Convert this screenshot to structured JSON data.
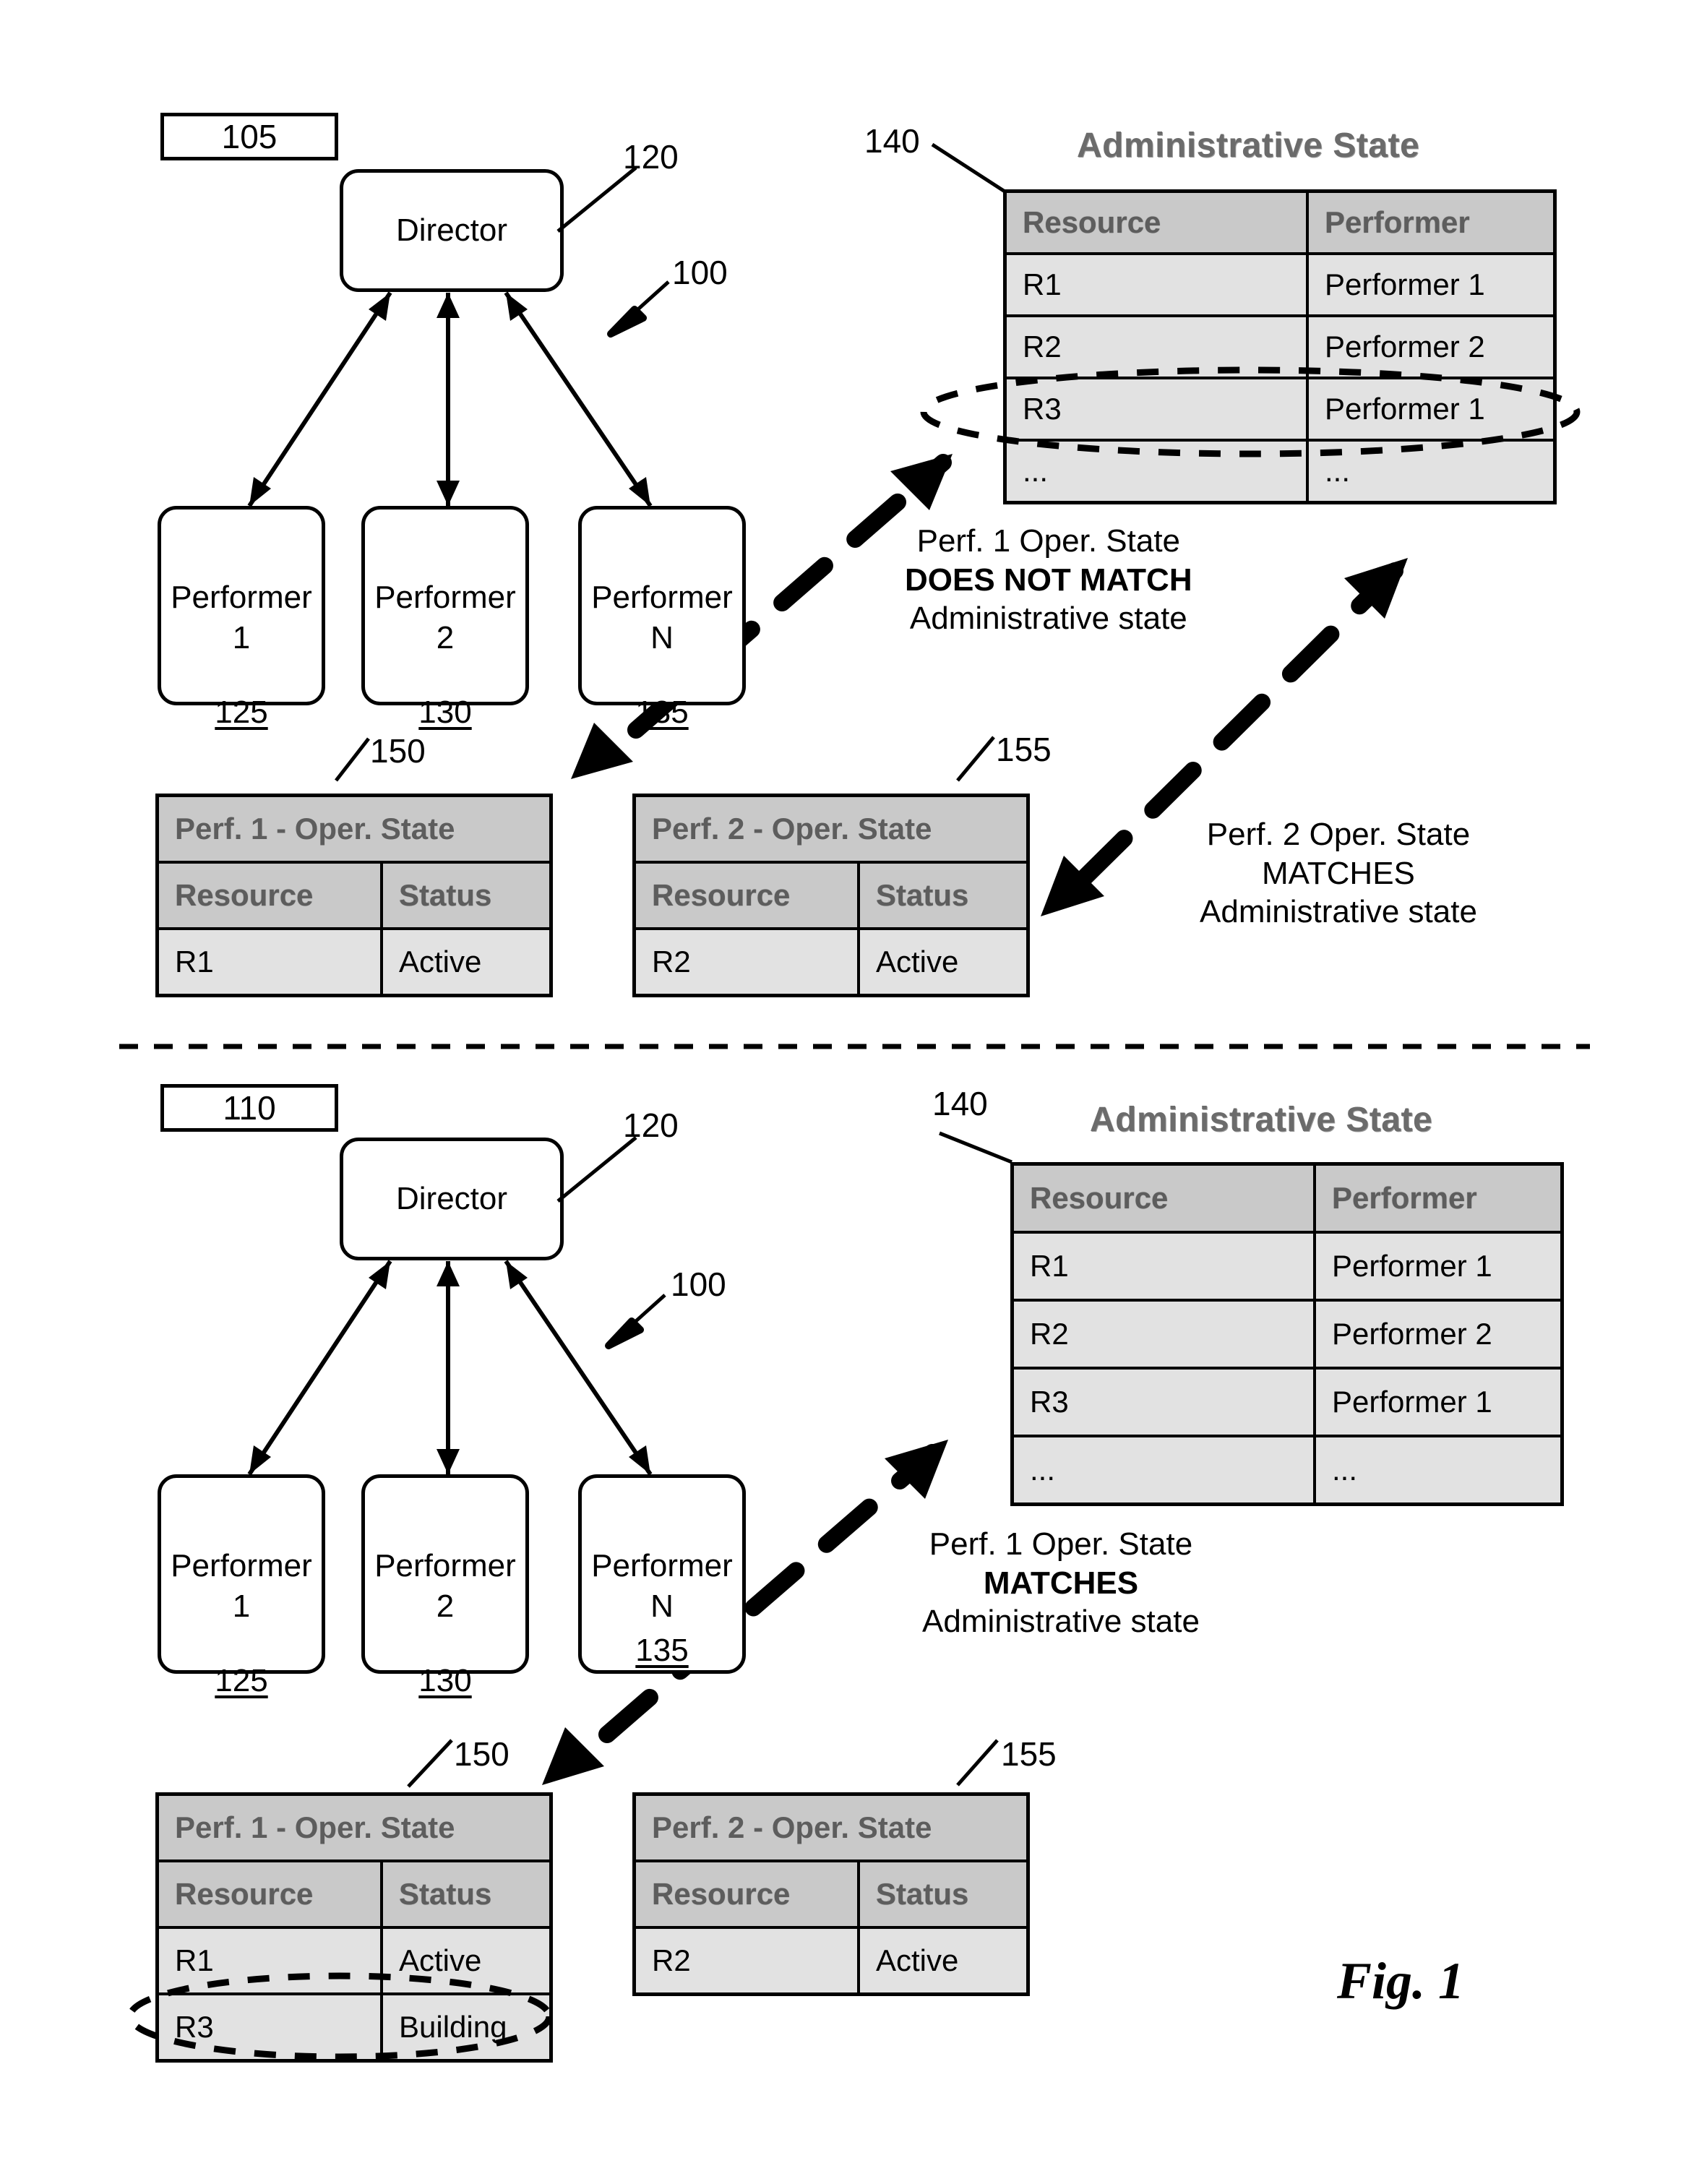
{
  "figure": {
    "label": "Fig. 1"
  },
  "panels": [
    {
      "id": "top",
      "ref_box": "105",
      "system_ref": "100",
      "director": {
        "label": "Director",
        "ref": "120"
      },
      "performers": [
        {
          "name": "Performer",
          "index": "1",
          "ref": "125"
        },
        {
          "name": "Performer",
          "index": "2",
          "ref": "130"
        },
        {
          "name": "Performer",
          "index": "N",
          "ref": "135"
        }
      ],
      "admin_state": {
        "title": "Administrative State",
        "ref": "140",
        "columns": [
          "Resource",
          "Performer"
        ],
        "rows": [
          [
            "R1",
            "Performer 1"
          ],
          [
            "R2",
            "Performer 2"
          ],
          [
            "R3",
            "Performer 1"
          ],
          [
            "...",
            "..."
          ]
        ],
        "highlighted_row_index": 2
      },
      "oper_tables": [
        {
          "ref": "150",
          "title": "Perf. 1 - Oper. State",
          "columns": [
            "Resource",
            "Status"
          ],
          "rows": [
            [
              "R1",
              "Active"
            ]
          ],
          "highlighted_row_index": -1
        },
        {
          "ref": "155",
          "title": "Perf. 2 - Oper. State",
          "columns": [
            "Resource",
            "Status"
          ],
          "rows": [
            [
              "R2",
              "Active"
            ]
          ],
          "highlighted_row_index": -1
        }
      ],
      "notes": [
        {
          "line1": "Perf. 1 Oper. State",
          "line2": "DOES NOT MATCH",
          "line3": "Administrative state",
          "emphasis": true
        },
        {
          "line1": "Perf. 2 Oper. State",
          "line2": "MATCHES",
          "line3": "Administrative state",
          "emphasis": false
        }
      ]
    },
    {
      "id": "bottom",
      "ref_box": "110",
      "system_ref": "100",
      "director": {
        "label": "Director",
        "ref": "120"
      },
      "performers": [
        {
          "name": "Performer",
          "index": "1",
          "ref": "125"
        },
        {
          "name": "Performer",
          "index": "2",
          "ref": "130"
        },
        {
          "name": "Performer",
          "index": "N",
          "ref": "135"
        }
      ],
      "admin_state": {
        "title": "Administrative State",
        "ref": "140",
        "columns": [
          "Resource",
          "Performer"
        ],
        "rows": [
          [
            "R1",
            "Performer 1"
          ],
          [
            "R2",
            "Performer 2"
          ],
          [
            "R3",
            "Performer 1"
          ],
          [
            "...",
            "..."
          ]
        ],
        "highlighted_row_index": -1
      },
      "oper_tables": [
        {
          "ref": "150",
          "title": "Perf. 1 - Oper. State",
          "columns": [
            "Resource",
            "Status"
          ],
          "rows": [
            [
              "R1",
              "Active"
            ],
            [
              "R3",
              "Building"
            ]
          ],
          "highlighted_row_index": 1
        },
        {
          "ref": "155",
          "title": "Perf. 2 - Oper. State",
          "columns": [
            "Resource",
            "Status"
          ],
          "rows": [
            [
              "R2",
              "Active"
            ]
          ],
          "highlighted_row_index": -1
        }
      ],
      "notes": [
        {
          "line1": "Perf. 1 Oper. State",
          "line2": "MATCHES",
          "line3": "Administrative state",
          "emphasis": true
        }
      ]
    }
  ]
}
